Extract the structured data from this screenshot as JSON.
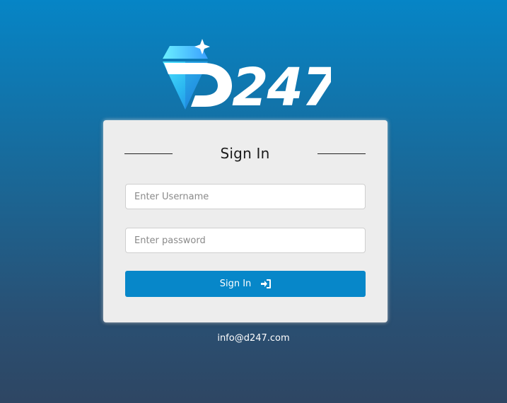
{
  "brand": {
    "logo_text": "D247",
    "logo_icon": "diamond-sparkle-icon",
    "accent_color": "#0787c9"
  },
  "login": {
    "title": "Sign In",
    "username_placeholder": "Enter Username",
    "username_value": "",
    "password_placeholder": "Enter password",
    "password_value": "",
    "submit_label": "Sign In",
    "submit_icon": "sign-in-icon"
  },
  "footer": {
    "email": "info@d247.com"
  }
}
